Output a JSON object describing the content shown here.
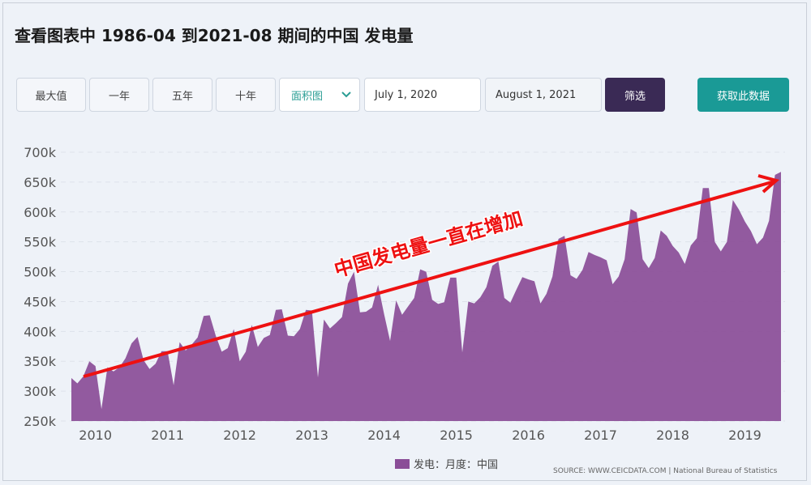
{
  "title": "查看图表中 1986-04 到2021-08 期间的中国 发电量",
  "controls": {
    "max": "最大值",
    "one_year": "一年",
    "five_year": "五年",
    "ten_year": "十年",
    "chart_type": "面积图",
    "start_date": "July 1, 2020",
    "end_date": "August 1, 2021",
    "filter": "筛选",
    "get_data": "获取此数据"
  },
  "annotation": "中国发电量一直在增加",
  "legend_label": "发电：月度：中国",
  "source": "SOURCE: WWW.CEICDATA.COM | National Bureau of Statistics",
  "colors": {
    "area": "#8a4d97",
    "arrow": "#ee1111",
    "filter_btn": "#3a2a55",
    "get_btn": "#1a9a96"
  },
  "chart_data": {
    "type": "area",
    "x_ticks": [
      "2010",
      "2011",
      "2012",
      "2013",
      "2014",
      "2015",
      "2016",
      "2017",
      "2018",
      "2019"
    ],
    "y_ticks": [
      "250k",
      "300k",
      "350k",
      "400k",
      "450k",
      "500k",
      "550k",
      "600k",
      "650k",
      "700k"
    ],
    "ylim": [
      250000,
      700000
    ],
    "grid": true,
    "start": "2009-09",
    "series": [
      {
        "name": "发电：月度：中国",
        "values": [
          322,
          313,
          325,
          350,
          342,
          270,
          340,
          333,
          340,
          355,
          380,
          391,
          352,
          337,
          346,
          367,
          367,
          310,
          382,
          368,
          378,
          390,
          426,
          427,
          393,
          366,
          372,
          404,
          350,
          366,
          411,
          374,
          389,
          394,
          436,
          437,
          393,
          392,
          404,
          436,
          435,
          323,
          420,
          405,
          414,
          424,
          480,
          500,
          432,
          433,
          440,
          478,
          429,
          384,
          452,
          428,
          442,
          456,
          504,
          500,
          453,
          446,
          449,
          490,
          490,
          365,
          450,
          447,
          457,
          474,
          510,
          517,
          456,
          448,
          470,
          491,
          487,
          484,
          447,
          463,
          492,
          555,
          560,
          494,
          488,
          503,
          533,
          528,
          524,
          519,
          479,
          492,
          521,
          605,
          599,
          521,
          506,
          523,
          569,
          560,
          543,
          532,
          513,
          544,
          556,
          640,
          640,
          550,
          534,
          550,
          620,
          604,
          584,
          568,
          546,
          557,
          585,
          662,
          667
        ]
      }
    ]
  }
}
